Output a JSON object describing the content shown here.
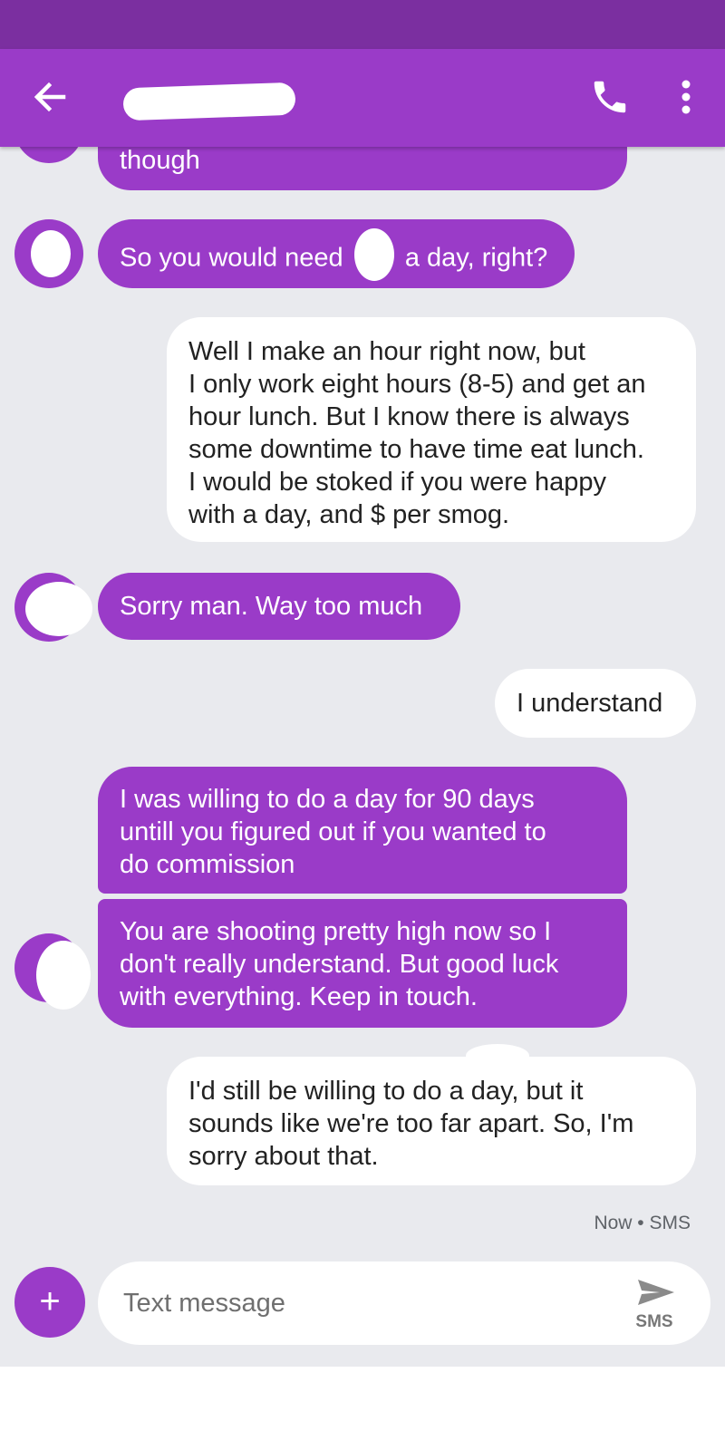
{
  "colors": {
    "accent": "#9a3bc8",
    "status_bar": "#7b2fa0",
    "background": "#e9eaee"
  },
  "header": {
    "back_icon": "arrow-back-icon",
    "call_icon": "phone-icon",
    "menu_icon": "more-vert-icon"
  },
  "messages": [
    {
      "dir": "in",
      "text": "though"
    },
    {
      "dir": "in",
      "before": "So you would need",
      "after": "a day, right?"
    },
    {
      "dir": "out",
      "text": "Well I make       an hour right now, but\nI only work eight hours (8-5) and get an\nhour lunch. But I know there is always\nsome downtime to have time eat lunch.\nI would be stoked if you were happy\nwith        a day, and $    per smog."
    },
    {
      "dir": "in",
      "text": "Sorry man. Way too much"
    },
    {
      "dir": "out",
      "text": "I understand"
    },
    {
      "dir": "in",
      "text": "I was willing to do       a day for 90 days\nuntill you figured out if you wanted to\ndo commission"
    },
    {
      "dir": "in",
      "text": "You are shooting pretty high now so I\ndon't really understand. But good luck\nwith everything. Keep in touch."
    },
    {
      "dir": "out",
      "text": "I'd still be willing to do         a day, but it\nsounds like we're too far apart. So, I'm\nsorry about that."
    }
  ],
  "timestamp": "Now • SMS",
  "compose": {
    "placeholder": "Text message",
    "send_label": "SMS",
    "add_label": "+",
    "send_icon": "send-icon"
  }
}
